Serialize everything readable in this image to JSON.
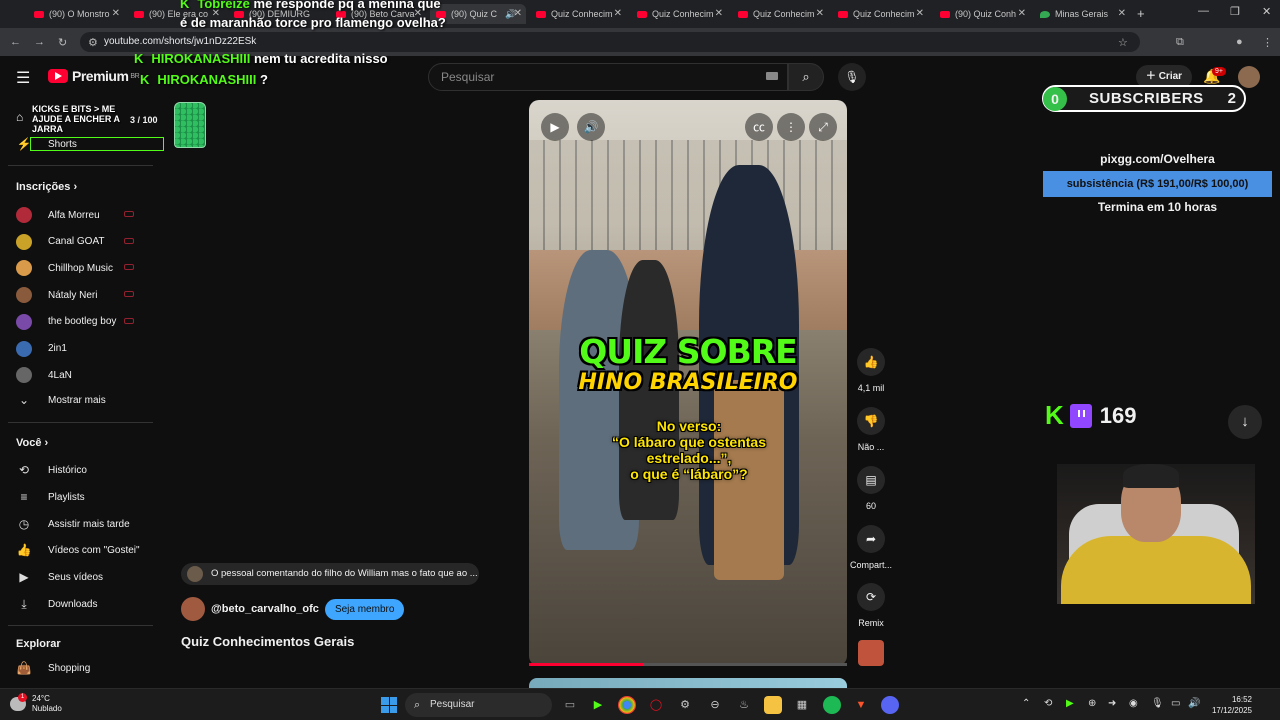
{
  "browser": {
    "tabs": [
      {
        "label": "(90) O Monstro",
        "favicon": "youtube-icon"
      },
      {
        "label": "(90) Ele era co",
        "favicon": "youtube-icon"
      },
      {
        "label": "(90) DEMIURG",
        "favicon": "youtube-icon"
      },
      {
        "label": "(90) Beto Carva",
        "favicon": "youtube-icon"
      },
      {
        "label": "(90) Quiz C",
        "favicon": "youtube-icon",
        "active": true
      },
      {
        "label": "Quiz Conhecim",
        "favicon": "youtube-icon"
      },
      {
        "label": "Quiz Conhecim",
        "favicon": "youtube-icon"
      },
      {
        "label": "Quiz Conhecim",
        "favicon": "youtube-icon"
      },
      {
        "label": "Quiz Conhecim",
        "favicon": "youtube-icon"
      },
      {
        "label": "(90) Quiz Conh",
        "favicon": "youtube-icon"
      },
      {
        "label": "Minas Gerais",
        "favicon": "maps-icon"
      }
    ],
    "url": "youtube.com/shorts/jw1nDz22ESk"
  },
  "overlay_chat": [
    {
      "user": "Tobreize",
      "message": "me responde pq a menina que é de maranhão torce pro flamengo ovelha?"
    },
    {
      "user": "HIROKANASHIII",
      "message": "nem tu acredita nisso"
    },
    {
      "user": "HIROKANASHIII",
      "message": "?"
    }
  ],
  "youtube": {
    "logo": "Premium",
    "logo_region": "BR",
    "search_placeholder": "Pesquisar",
    "create_label": "Criar",
    "notifications_count": "9+"
  },
  "sidebar": {
    "shorts": "Shorts",
    "subscriptions_title": "Inscrições",
    "channels": [
      {
        "name": "Alfa Morreu",
        "color": "#b02a3a"
      },
      {
        "name": "Canal GOAT",
        "color": "#c9a227"
      },
      {
        "name": "Chillhop Music",
        "color": "#d99a4a"
      },
      {
        "name": "Nátaly Neri",
        "color": "#8a5a3c"
      },
      {
        "name": "the bootleg boy",
        "color": "#7a4aa8"
      },
      {
        "name": "2in1",
        "color": "#3a6ab0"
      },
      {
        "name": "4LaN",
        "color": "#666666"
      }
    ],
    "show_more": "Mostrar mais",
    "you_title": "Você",
    "you_items": [
      "Histórico",
      "Playlists",
      "Assistir mais tarde",
      "Vídeos com \"Gostei\"",
      "Seus vídeos",
      "Downloads"
    ],
    "explore_title": "Explorar",
    "explore_items": [
      "Shopping"
    ]
  },
  "overlay_jar": {
    "label": "KICKS E BITS > ME AJUDE A ENCHER A JARRA",
    "count": "3 / 100"
  },
  "short": {
    "title_line1": "QUIZ SOBRE",
    "title_line2": "HINO BRASILEIRO",
    "question": "No verso:\n“O lábaro que ostentas estrelado...”,\no que é “lábaro”?",
    "progress": 0.36,
    "likes": "4,1 mil",
    "dislike_label": "Não ...",
    "comments": "60",
    "share_label": "Compart...",
    "remix_label": "Remix",
    "comment_preview": "O pessoal comentando do filho do William mas o fato que ao ...",
    "channel": "@beto_carvalho_ofc",
    "join_label": "Seja membro",
    "video_title": "Quiz Conhecimentos Gerais"
  },
  "stream_overlay": {
    "subs_left": "0",
    "subs_label": "SUBSCRIBERS",
    "subs_right": "2",
    "pix_url": "pixgg.com/Ovelhera",
    "goal_text": "subsistência (R$ 191,00/R$ 100,00)",
    "goal_end": "Termina em 10 horas",
    "viewers": "169"
  },
  "taskbar": {
    "temperature": "24°C",
    "weather": "Nublado",
    "weather_alert": "1",
    "search": "Pesquisar",
    "time": "16:52",
    "date": "17/12/2025"
  }
}
